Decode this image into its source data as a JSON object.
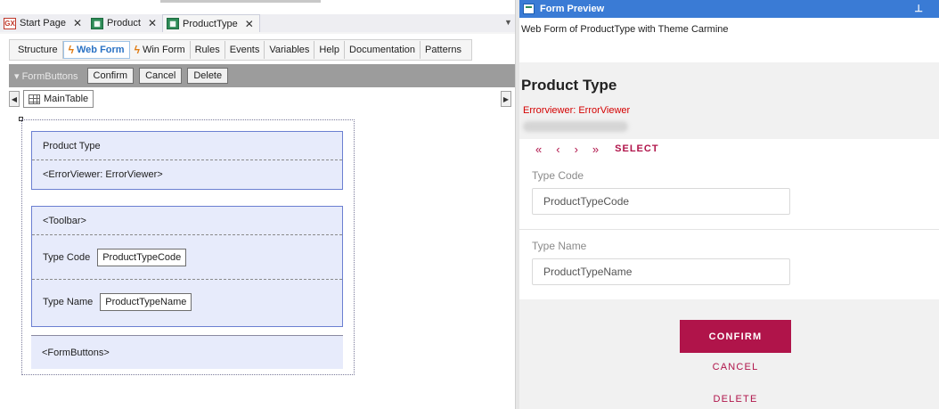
{
  "doc_tabs": [
    {
      "label": "Start Page",
      "icon": "gx-icon",
      "active": false
    },
    {
      "label": "Product",
      "icon": "grid-icon",
      "active": false
    },
    {
      "label": "ProductType",
      "icon": "grid-icon",
      "active": true
    }
  ],
  "sub_tabs": [
    "Structure",
    "Web Form",
    "Win Form",
    "Rules",
    "Events",
    "Variables",
    "Help",
    "Documentation",
    "Patterns"
  ],
  "form_bar": {
    "label": "FormButtons",
    "buttons": [
      "Confirm",
      "Cancel",
      "Delete"
    ]
  },
  "designer": {
    "main_table": "MainTable",
    "title": "Product Type",
    "error_viewer": "<ErrorViewer: ErrorViewer>",
    "toolbar": "<Toolbar>",
    "fields": [
      {
        "label": "Type Code",
        "control": "ProductTypeCode"
      },
      {
        "label": "Type Name",
        "control": "ProductTypeName"
      }
    ],
    "form_buttons": "<FormButtons>"
  },
  "preview": {
    "window_title": "Form Preview",
    "subtitle": "Web Form of ProductType with Theme Carmine",
    "title": "Product Type",
    "error_viewer": "Errorviewer: ErrorViewer",
    "nav": {
      "first": "«",
      "prev": "‹",
      "next": "›",
      "last": "»",
      "select": "SELECT"
    },
    "fields": [
      {
        "label": "Type Code",
        "value": "ProductTypeCode"
      },
      {
        "label": "Type Name",
        "value": "ProductTypeName"
      }
    ],
    "confirm": "CONFIRM",
    "cancel": "CANCEL",
    "delete": "DELETE"
  },
  "colors": {
    "accent": "#b0144a",
    "preview_header": "#3a7bd5",
    "designer_block": "#e7ebfb"
  }
}
